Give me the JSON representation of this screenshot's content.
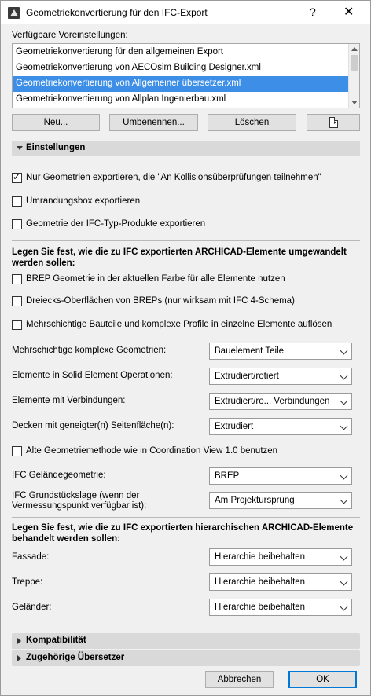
{
  "window": {
    "title": "Geometriekonvertierung für den IFC-Export",
    "help": "?",
    "close": "✕"
  },
  "presets": {
    "label": "Verfügbare Voreinstellungen:",
    "items": [
      "Geometriekonvertierung für den allgemeinen Export",
      "Geometriekonvertierung von AECOsim Building Designer.xml",
      "Geometriekonvertierung von Allgemeiner übersetzer.xml",
      "Geometriekonvertierung von Allplan Ingenierbau.xml"
    ],
    "selected_index": 2
  },
  "buttons": {
    "new": "Neu...",
    "rename": "Umbenennen...",
    "delete": "Löschen",
    "cancel": "Abbrechen",
    "ok": "OK"
  },
  "sections": {
    "settings": "Einstellungen",
    "compat": "Kompatibilität",
    "translators": "Zugehörige Übersetzer"
  },
  "checks": {
    "only_collision": {
      "label": "Nur Geometrien exportieren, die \"An Kollisionsüberprüfungen teilnehmen\"",
      "checked": true
    },
    "bbox": {
      "label": "Umrandungsbox exportieren",
      "checked": false
    },
    "type_geom": {
      "label": "Geometrie der IFC-Typ-Produkte exportieren",
      "checked": false
    },
    "brep_color": {
      "label": "BREP Geometrie in der aktuellen Farbe für alle Elemente nutzen",
      "checked": false
    },
    "triangles": {
      "label": "Dreiecks-Oberflächen von BREPs (nur wirksam mit IFC 4-Schema)",
      "checked": false
    },
    "split_layers": {
      "label": "Mehrschichtige Bauteile und komplexe Profile in einzelne Elemente auflösen",
      "checked": false
    },
    "legacy_cv": {
      "label": "Alte Geometriemethode wie in Coordination View 1.0 benutzen",
      "checked": false
    }
  },
  "groups": {
    "convert_heading": "Legen Sie fest, wie die zu IFC exportierten ARCHICAD-Elemente umgewandelt werden sollen:",
    "hierarchy_heading": "Legen Sie fest, wie die zu IFC exportierten hierarchischen ARCHICAD-Elemente behandelt werden sollen:"
  },
  "fields": {
    "multilayer": {
      "label": "Mehrschichtige komplexe Geometrien:",
      "value": "Bauelement Teile"
    },
    "solid_ops": {
      "label": "Elemente in Solid Element Operationen:",
      "value": "Extrudiert/rotiert"
    },
    "connections": {
      "label": "Elemente mit Verbindungen:",
      "value": "Extrudiert/ro... Verbindungen"
    },
    "slabs": {
      "label": "Decken mit geneigter(n) Seitenfläche(n):",
      "value": "Extrudiert"
    },
    "terrain": {
      "label": "IFC Geländegeometrie:",
      "value": "BREP"
    },
    "site": {
      "label": "IFC Grundstückslage (wenn der Vermessungspunkt verfügbar ist):",
      "value": "Am Projektursprung"
    },
    "facade": {
      "label": "Fassade:",
      "value": "Hierarchie beibehalten"
    },
    "stair": {
      "label": "Treppe:",
      "value": "Hierarchie beibehalten"
    },
    "railing": {
      "label": "Geländer:",
      "value": "Hierarchie beibehalten"
    }
  }
}
